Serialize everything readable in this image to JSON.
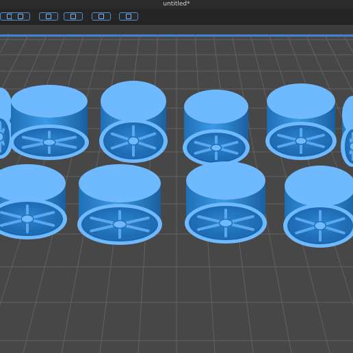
{
  "window": {
    "title": "untitled*"
  },
  "toolbar": {
    "buttons": [
      {
        "icon": "layers-icon"
      },
      {
        "icon": "slice-icon"
      },
      {
        "icon": "support-tree-icon"
      },
      {
        "icon": "resin-drop-icon"
      },
      {
        "icon": "frame-icon"
      },
      {
        "icon": "print-lock-icon"
      }
    ]
  },
  "scene": {
    "plate_color": "#4b4b4b",
    "grid_color": "#626262",
    "border_color": "#3f87d8",
    "model_color": "#2f8ed8",
    "model_shadow": "#1f6fb6",
    "model_highlight": "#6fb9ff",
    "model_count": 10
  }
}
